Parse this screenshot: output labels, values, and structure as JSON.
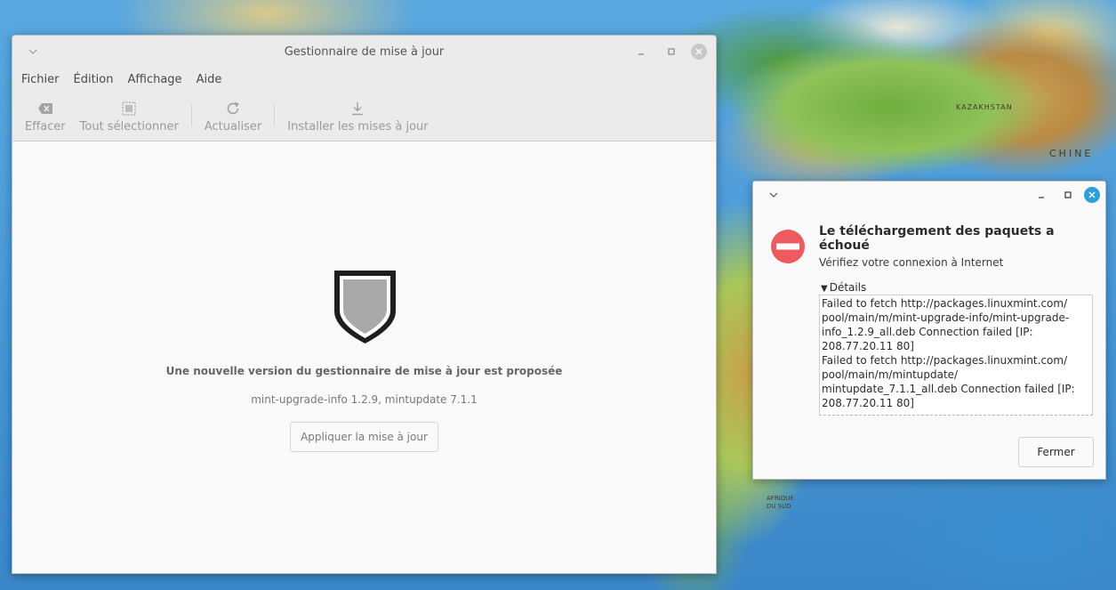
{
  "desktop": {
    "map_labels": {
      "kazakhstan": "KAZAKHSTAN",
      "chine": "CHINE",
      "afrique": "AFRIQUE\nDU SUD"
    }
  },
  "main_window": {
    "title": "Gestionnaire de mise à jour",
    "menu": [
      "Fichier",
      "Édition",
      "Affichage",
      "Aide"
    ],
    "toolbar": {
      "clear": "Effacer",
      "select_all": "Tout sélectionner",
      "refresh": "Actualiser",
      "install": "Installer les mises à jour"
    },
    "content": {
      "heading": "Une nouvelle version du gestionnaire de mise à jour est proposée",
      "versions": "mint-upgrade-info 1.2.9, mintupdate 7.1.1",
      "apply_button": "Appliquer la mise à jour"
    }
  },
  "error_dialog": {
    "title": "Le téléchargement des paquets a échoué",
    "message": "Vérifiez votre connexion à Internet",
    "details_label": "Détails",
    "details_text": "Failed to fetch http://packages.linuxmint.com/\npool/main/m/mint-upgrade-info/mint-upgrade-\ninfo_1.2.9_all.deb Connection failed [IP:\n208.77.20.11 80]\nFailed to fetch http://packages.linuxmint.com/\npool/main/m/mintupdate/\nmintupdate_7.1.1_all.deb Connection failed [IP:\n208.77.20.11 80]",
    "close_button": "Fermer"
  },
  "icons": {
    "window_menu": "chevron-down-icon",
    "minimize": "minimize-icon",
    "maximize": "maximize-icon",
    "close": "close-icon",
    "clear": "backspace-icon",
    "select_all": "select-all-icon",
    "refresh": "refresh-icon",
    "install": "download-icon",
    "shield": "shield-icon",
    "error": "error-icon"
  },
  "colors": {
    "error_red": "#ee5a5f",
    "close_blue": "#2d9fd9",
    "window_bg": "#fafafa",
    "titlebar_bg": "#ebebeb"
  }
}
